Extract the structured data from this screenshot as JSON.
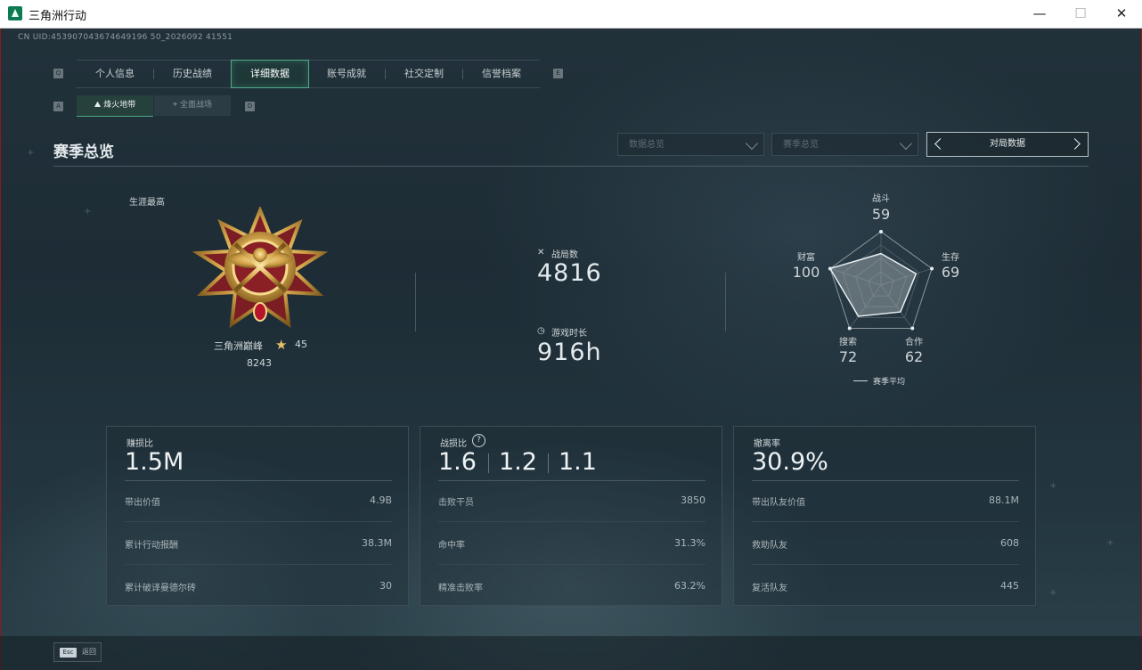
{
  "window": {
    "title": "三角洲行动",
    "minimize": "—",
    "maximize": "☐",
    "close": "✕"
  },
  "uid": "CN UID:453907043674649196 50_2026092 41551",
  "nav": {
    "left_key": "Q",
    "right_key": "E",
    "tabs": [
      "个人信息",
      "历史战绩",
      "详细数据",
      "账号成就",
      "社交定制",
      "信誉档案"
    ],
    "active_index": 2
  },
  "subnav": {
    "left_key": "A",
    "right_key": "D",
    "tabs": [
      "烽火地带",
      "全面战场"
    ],
    "active_index": 0
  },
  "section": {
    "title": "赛季总览"
  },
  "filters": {
    "data_overview": "数据总览",
    "season_overview": "赛季总览",
    "match_data": "对局数据"
  },
  "career": {
    "label": "生涯最高",
    "rank_name": "三角洲巅峰",
    "rank_level": "45",
    "rank_score": "8243"
  },
  "matches": {
    "count_label": "战局数",
    "count_value": "4816",
    "time_label": "游戏时长",
    "time_value": "916h"
  },
  "radar": {
    "axes": [
      {
        "label": "战斗",
        "value": "59"
      },
      {
        "label": "生存",
        "value": "69"
      },
      {
        "label": "合作",
        "value": "62"
      },
      {
        "label": "搜索",
        "value": "72"
      },
      {
        "label": "财富",
        "value": "100"
      }
    ],
    "values": [
      59,
      69,
      62,
      72,
      100
    ],
    "max": 100,
    "legend": "赛季平均"
  },
  "cards": [
    {
      "label": "赚损比",
      "big": "1.5M",
      "rows": [
        {
          "k": "带出价值",
          "v": "4.9B"
        },
        {
          "k": "累计行动报酬",
          "v": "38.3M"
        },
        {
          "k": "累计破译曼德尔砖",
          "v": "30"
        }
      ]
    },
    {
      "label": "战损比",
      "help": "?",
      "big_values": [
        "1.6",
        "1.2",
        "1.1"
      ],
      "rows": [
        {
          "k": "击败干员",
          "v": "3850"
        },
        {
          "k": "命中率",
          "v": "31.3%"
        },
        {
          "k": "精准击败率",
          "v": "63.2%"
        }
      ]
    },
    {
      "label": "撤离率",
      "big": "30.9%",
      "rows": [
        {
          "k": "带出队友价值",
          "v": "88.1M"
        },
        {
          "k": "救助队友",
          "v": "608"
        },
        {
          "k": "复活队友",
          "v": "445"
        }
      ]
    }
  ],
  "footer": {
    "esc_key": "Esc",
    "back_label": "返回"
  },
  "colors": {
    "accent": "#4ea989",
    "text": "#cfd6d9",
    "background": "#1f2e37"
  }
}
